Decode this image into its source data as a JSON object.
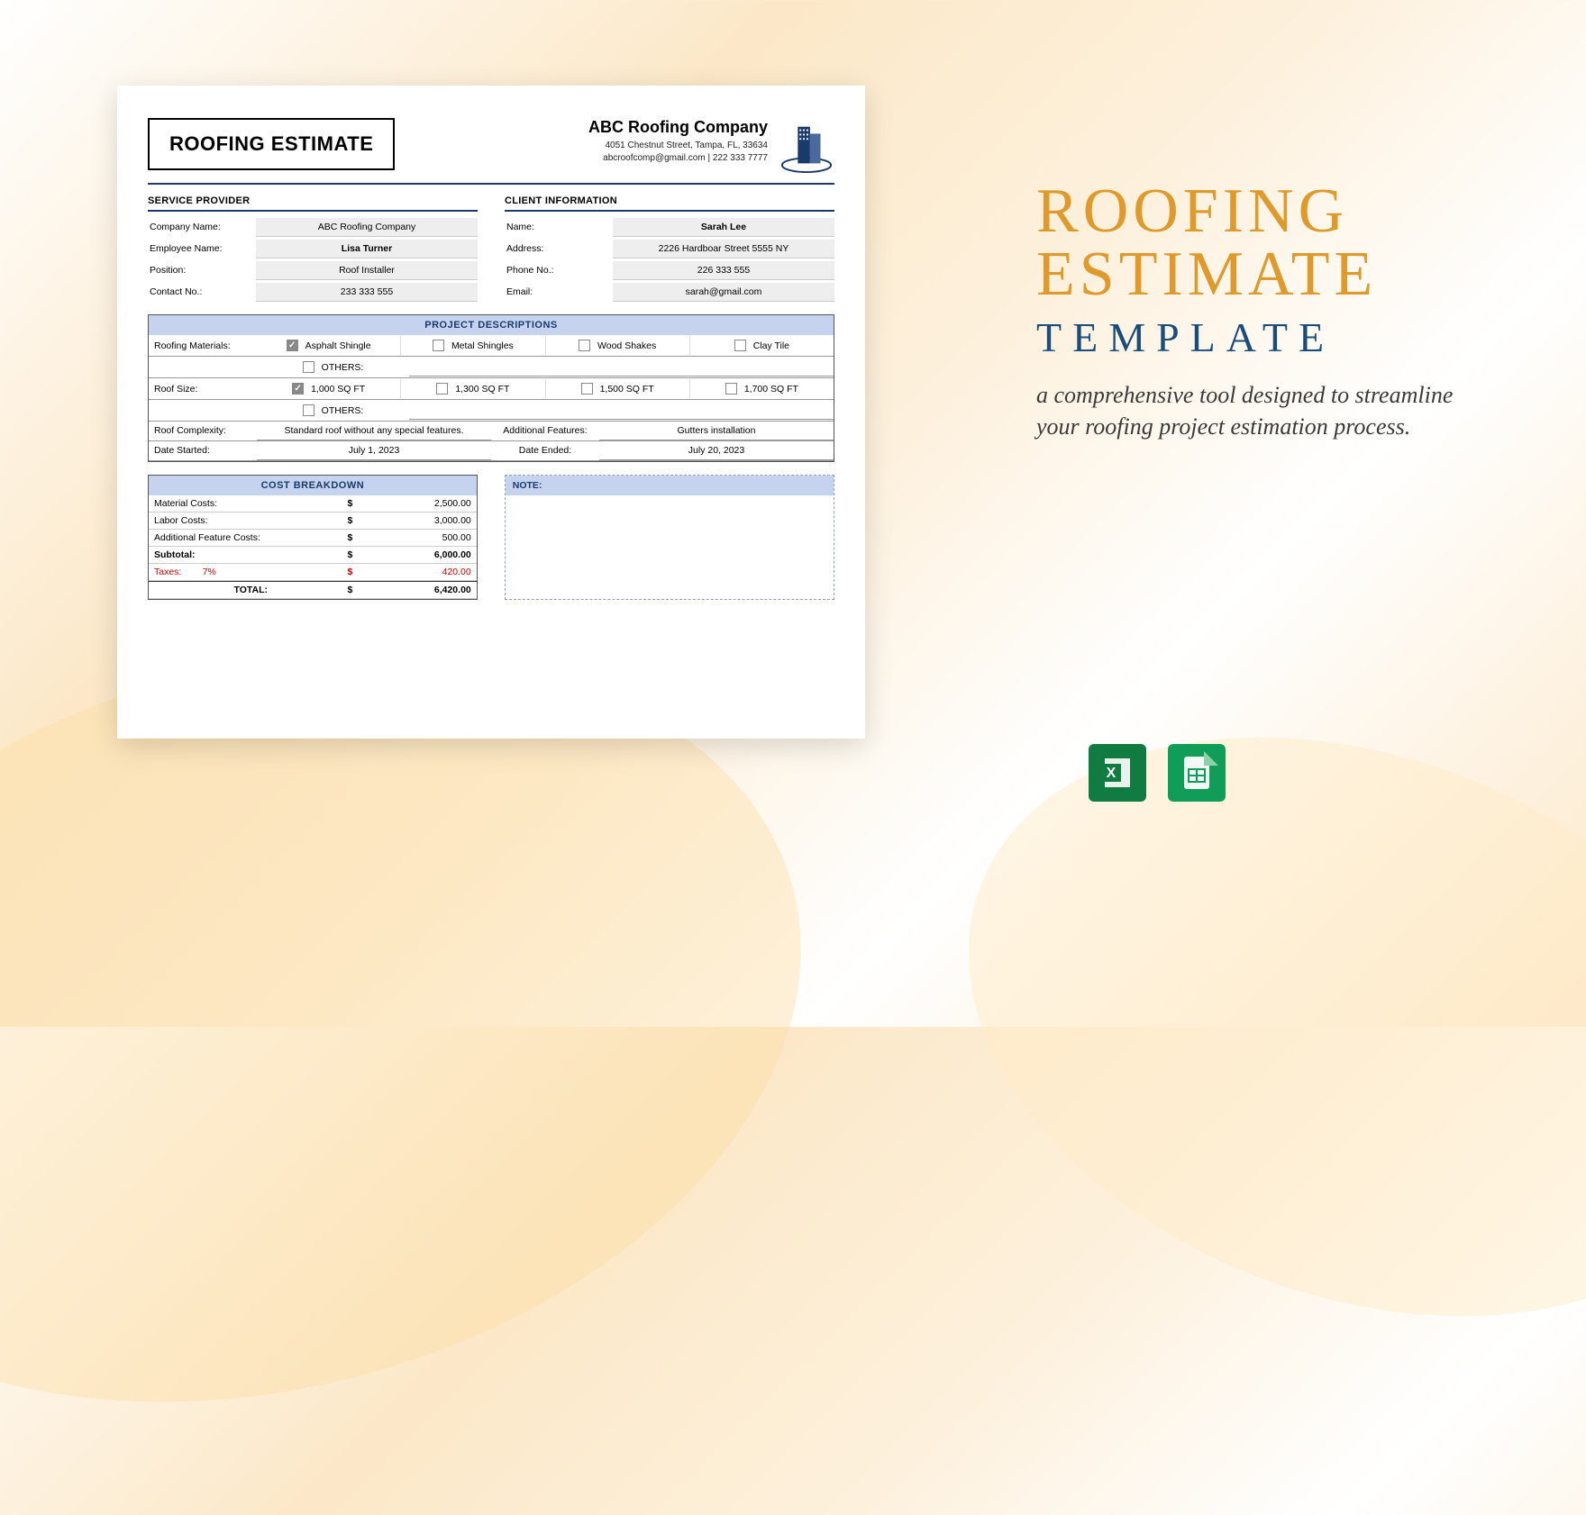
{
  "doc_title": "ROOFING ESTIMATE",
  "company": {
    "name": "ABC Roofing Company",
    "address": "4051 Chestnut Street, Tampa, FL, 33634",
    "contact": "abcroofcomp@gmail.com | 222 333 7777"
  },
  "provider": {
    "title": "SERVICE PROVIDER",
    "fields": [
      {
        "label": "Company Name:",
        "value": "ABC Roofing Company"
      },
      {
        "label": "Employee Name:",
        "value": "Lisa Turner"
      },
      {
        "label": "Position:",
        "value": "Roof Installer"
      },
      {
        "label": "Contact No.:",
        "value": "233 333 555"
      }
    ]
  },
  "client": {
    "title": "CLIENT INFORMATION",
    "fields": [
      {
        "label": "Name:",
        "value": "Sarah Lee"
      },
      {
        "label": "Address:",
        "value": "2226 Hardboar Street 5555 NY"
      },
      {
        "label": "Phone No.:",
        "value": "226 333 555"
      },
      {
        "label": "Email:",
        "value": "sarah@gmail.com"
      }
    ]
  },
  "project": {
    "title": "PROJECT DESCRIPTIONS",
    "materials": {
      "label": "Roofing Materials:",
      "options": [
        {
          "label": "Asphalt Shingle",
          "checked": true
        },
        {
          "label": "Metal Shingles",
          "checked": false
        },
        {
          "label": "Wood Shakes",
          "checked": false
        },
        {
          "label": "Clay Tile",
          "checked": false
        }
      ],
      "others": "OTHERS:"
    },
    "size": {
      "label": "Roof Size:",
      "options": [
        {
          "label": "1,000 SQ FT",
          "checked": true
        },
        {
          "label": "1,300 SQ FT",
          "checked": false
        },
        {
          "label": "1,500 SQ FT",
          "checked": false
        },
        {
          "label": "1,700 SQ FT",
          "checked": false
        }
      ],
      "others": "OTHERS:"
    },
    "complexity": {
      "label": "Roof Complexity:",
      "value": "Standard roof without any special features."
    },
    "features": {
      "label": "Additional Features:",
      "value": "Gutters installation"
    },
    "start": {
      "label": "Date Started:",
      "value": "July 1, 2023"
    },
    "end": {
      "label": "Date Ended:",
      "value": "July 20, 2023"
    }
  },
  "cost": {
    "title": "COST BREAKDOWN",
    "rows": [
      {
        "label": "Material Costs:",
        "cur": "$",
        "value": "2,500.00"
      },
      {
        "label": "Labor Costs:",
        "cur": "$",
        "value": "3,000.00"
      },
      {
        "label": "Additional Feature Costs:",
        "cur": "$",
        "value": "500.00"
      }
    ],
    "subtotal": {
      "label": "Subtotal:",
      "cur": "$",
      "value": "6,000.00"
    },
    "tax": {
      "label": "Taxes:",
      "pct": "7%",
      "cur": "$",
      "value": "420.00"
    },
    "total": {
      "label": "TOTAL:",
      "cur": "$",
      "value": "6,420.00"
    }
  },
  "note": {
    "title": "NOTE:"
  },
  "promo": {
    "line1": "ROOFING",
    "line2": "ESTIMATE",
    "line3": "TEMPLATE",
    "desc": "a comprehensive tool designed to streamline your roofing project estimation process."
  }
}
